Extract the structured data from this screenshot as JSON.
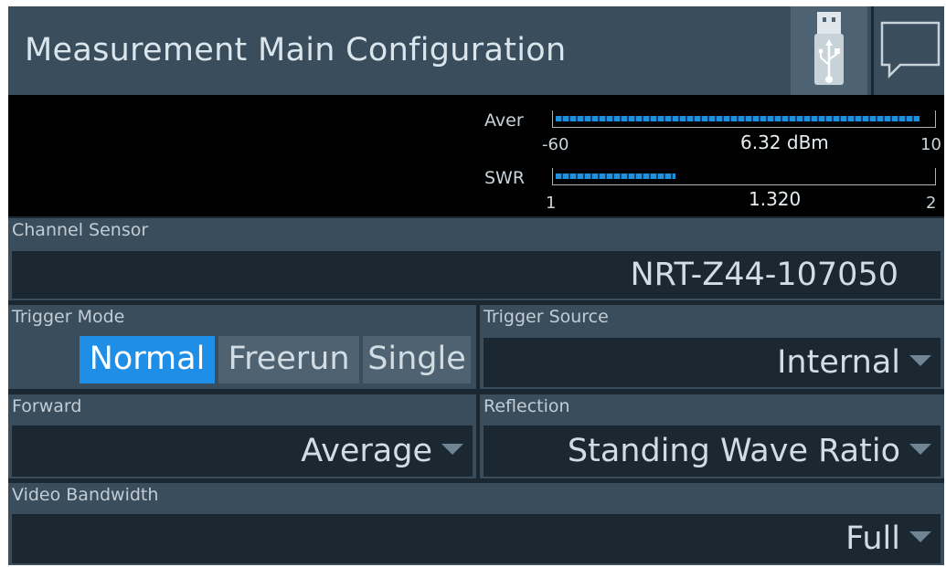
{
  "header": {
    "title": "Measurement Main Configuration",
    "usb_icon": "usb-icon",
    "message_icon": "speech-bubble-icon"
  },
  "meter": {
    "average": {
      "label": "Aver",
      "min": "-60",
      "max": "10",
      "value": "6.32 dBm",
      "fill_fraction": 0.97
    },
    "swr": {
      "label": "SWR",
      "min": "1",
      "max": "2",
      "value": "1.320",
      "fill_fraction": 0.32
    },
    "bar_color": "#1f8fe0"
  },
  "channel_sensor": {
    "label": "Channel Sensor",
    "value": "NRT-Z44-107050"
  },
  "trigger_mode": {
    "label": "Trigger Mode",
    "options": [
      "Normal",
      "Freerun",
      "Single"
    ],
    "selected": "Normal"
  },
  "trigger_source": {
    "label": "Trigger Source",
    "value": "Internal"
  },
  "forward": {
    "label": "Forward",
    "value": "Average"
  },
  "reflection": {
    "label": "Reflection",
    "value": "Standing Wave Ratio"
  },
  "video_bandwidth": {
    "label": "Video Bandwidth",
    "value": "Full"
  },
  "colors": {
    "accent": "#1e8ee6",
    "panel": "#3a4d5c",
    "field": "#1b2731"
  }
}
